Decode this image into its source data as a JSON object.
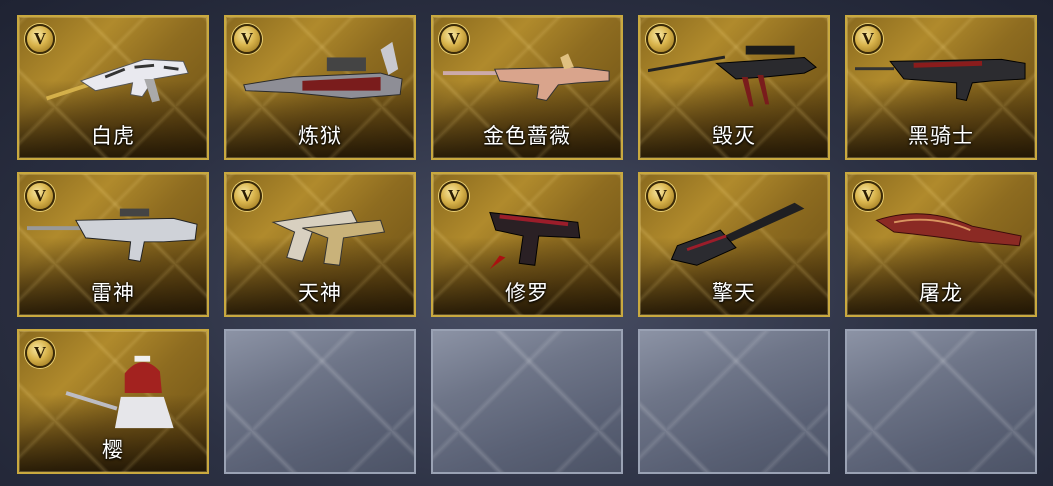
{
  "badge_letter": "V",
  "rows": [
    [
      {
        "name": "白虎",
        "icon": "assault-rifle-white-tiger-icon"
      },
      {
        "name": "炼狱",
        "icon": "heavy-gun-inferno-icon"
      },
      {
        "name": "金色蔷薇",
        "icon": "rifle-golden-rose-icon"
      },
      {
        "name": "毁灭",
        "icon": "sniper-rifle-destruction-icon"
      },
      {
        "name": "黑骑士",
        "icon": "rifle-black-knight-icon"
      }
    ],
    [
      {
        "name": "雷神",
        "icon": "rifle-thor-icon"
      },
      {
        "name": "天神",
        "icon": "dual-pistols-god-icon"
      },
      {
        "name": "修罗",
        "icon": "pistol-asura-icon"
      },
      {
        "name": "擎天",
        "icon": "shovel-sky-icon"
      },
      {
        "name": "屠龙",
        "icon": "blade-dragon-slayer-icon"
      }
    ],
    [
      {
        "name": "樱",
        "icon": "character-nurse-sakura-icon"
      }
    ]
  ],
  "empty_slots": 4
}
